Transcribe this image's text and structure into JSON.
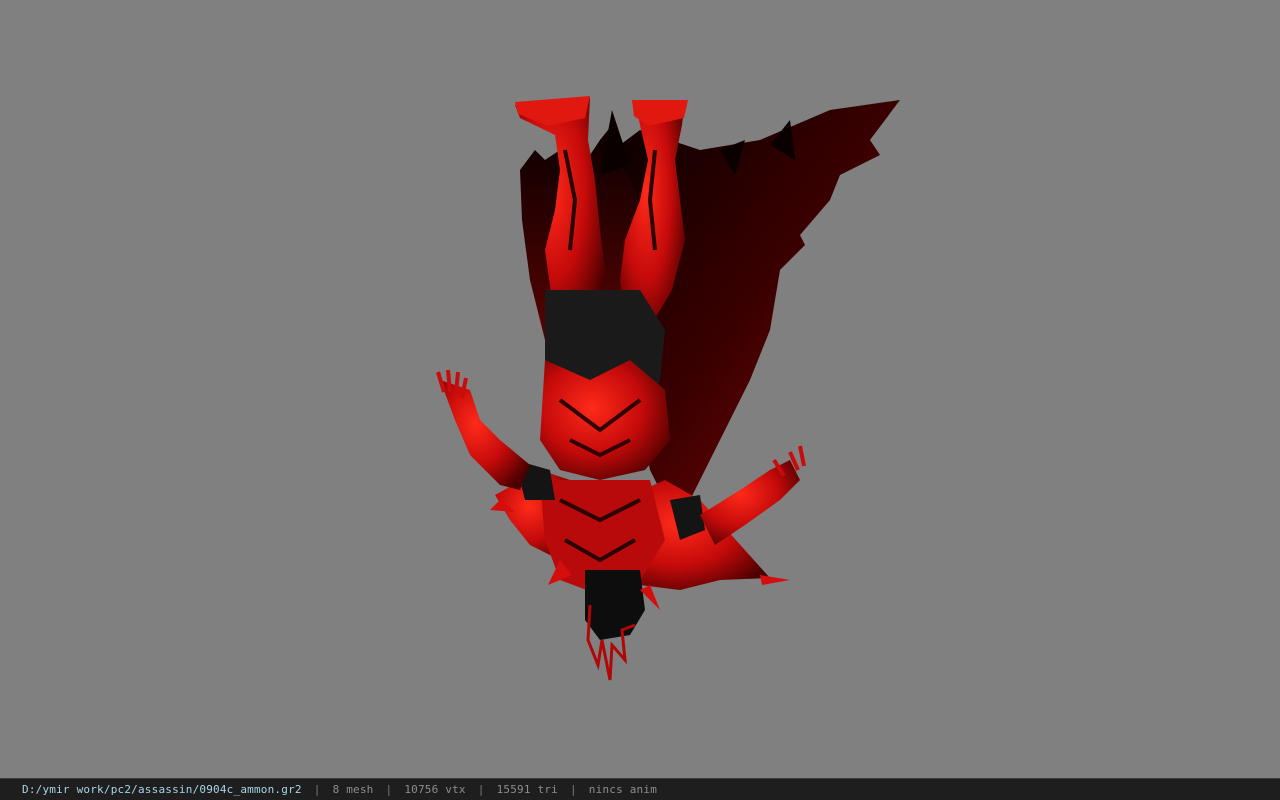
{
  "viewer": {
    "background_color": "#808080",
    "model": {
      "subject": "upside-down red armored assassin character model with dark cape",
      "primary_color": "#d40d0d",
      "shadow_color": "#1a0000"
    }
  },
  "statusbar": {
    "file_path": "D:/ymir work/pc2/assassin/0904c_ammon.gr2",
    "separator": "|",
    "mesh_count": "8 mesh",
    "vertex_count": "10756 vtx",
    "triangle_count": "15591 tri",
    "anim_status": "nincs anim"
  }
}
